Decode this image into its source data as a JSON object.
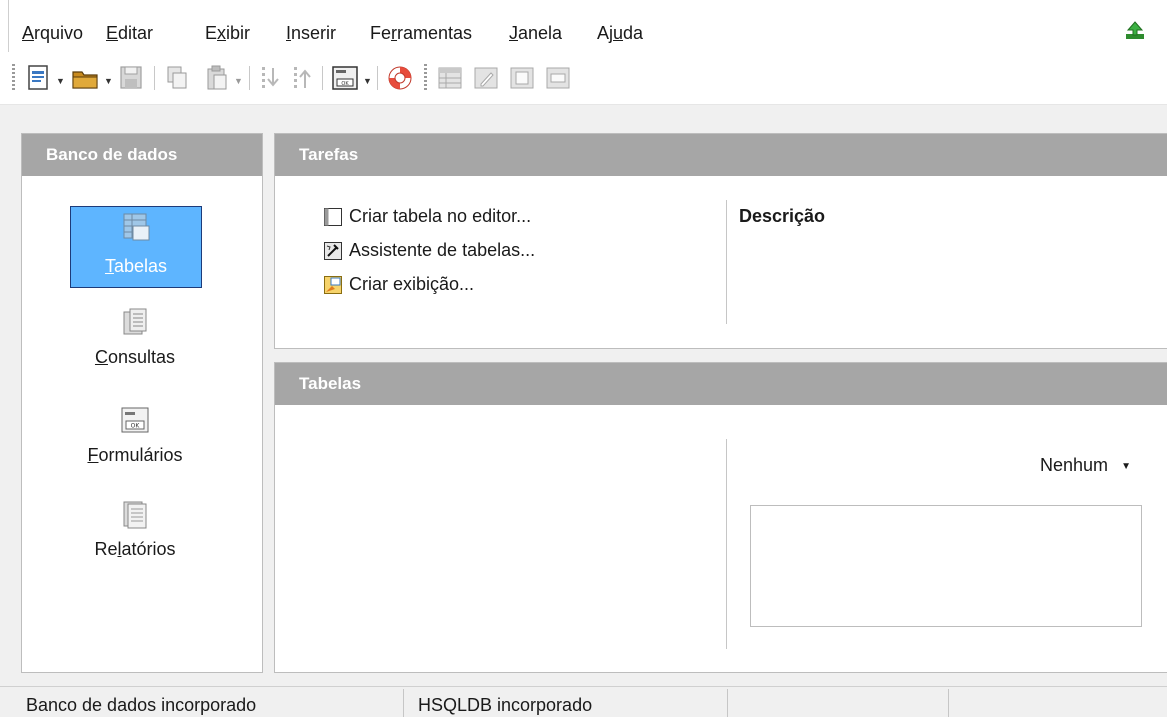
{
  "menubar": {
    "items": [
      {
        "pre": "",
        "u": "A",
        "post": "rquivo"
      },
      {
        "pre": "",
        "u": "E",
        "post": "ditar"
      },
      {
        "pre": "E",
        "u": "x",
        "post": "ibir"
      },
      {
        "pre": "",
        "u": "I",
        "post": "nserir"
      },
      {
        "pre": "Fe",
        "u": "r",
        "post": "ramentas"
      },
      {
        "pre": "",
        "u": "J",
        "post": "anela"
      },
      {
        "pre": "Aj",
        "u": "u",
        "post": "da"
      }
    ]
  },
  "toolbar": {
    "icons": [
      "new-document-icon",
      "open-folder-icon",
      "save-icon",
      "copy-icon",
      "paste-icon",
      "sort-ascending-icon",
      "sort-descending-icon",
      "form-icon",
      "help-lifebuoy-icon",
      "table-icon",
      "edit-icon",
      "delete-icon",
      "rename-icon"
    ]
  },
  "database_panel": {
    "title": "Banco de dados",
    "items": [
      {
        "pre": "",
        "u": "T",
        "post": "abelas",
        "icon": "tables-icon",
        "selected": true
      },
      {
        "pre": "",
        "u": "C",
        "post": "onsultas",
        "icon": "queries-icon",
        "selected": false
      },
      {
        "pre": "",
        "u": "F",
        "post": "ormulários",
        "icon": "forms-icon",
        "selected": false
      },
      {
        "pre": "Re",
        "u": "l",
        "post": "atórios",
        "icon": "reports-icon",
        "selected": false
      }
    ]
  },
  "tasks_panel": {
    "title": "Tarefas",
    "tasks": [
      {
        "label": "Criar tabela no editor...",
        "icon": "create-table-icon"
      },
      {
        "label": "Assistente de tabelas...",
        "icon": "table-wizard-icon"
      },
      {
        "label": "Criar exibição...",
        "icon": "create-view-icon"
      }
    ],
    "description_title": "Descrição"
  },
  "tables_panel": {
    "title": "Tabelas",
    "preview_mode": "Nenhum"
  },
  "statusbar": {
    "cells": [
      "Banco de dados incorporado",
      "HSQLDB incorporado",
      "",
      ""
    ]
  },
  "colors": {
    "selected_bg": "#5eb5ff",
    "header_bg": "#a6a6a6"
  }
}
